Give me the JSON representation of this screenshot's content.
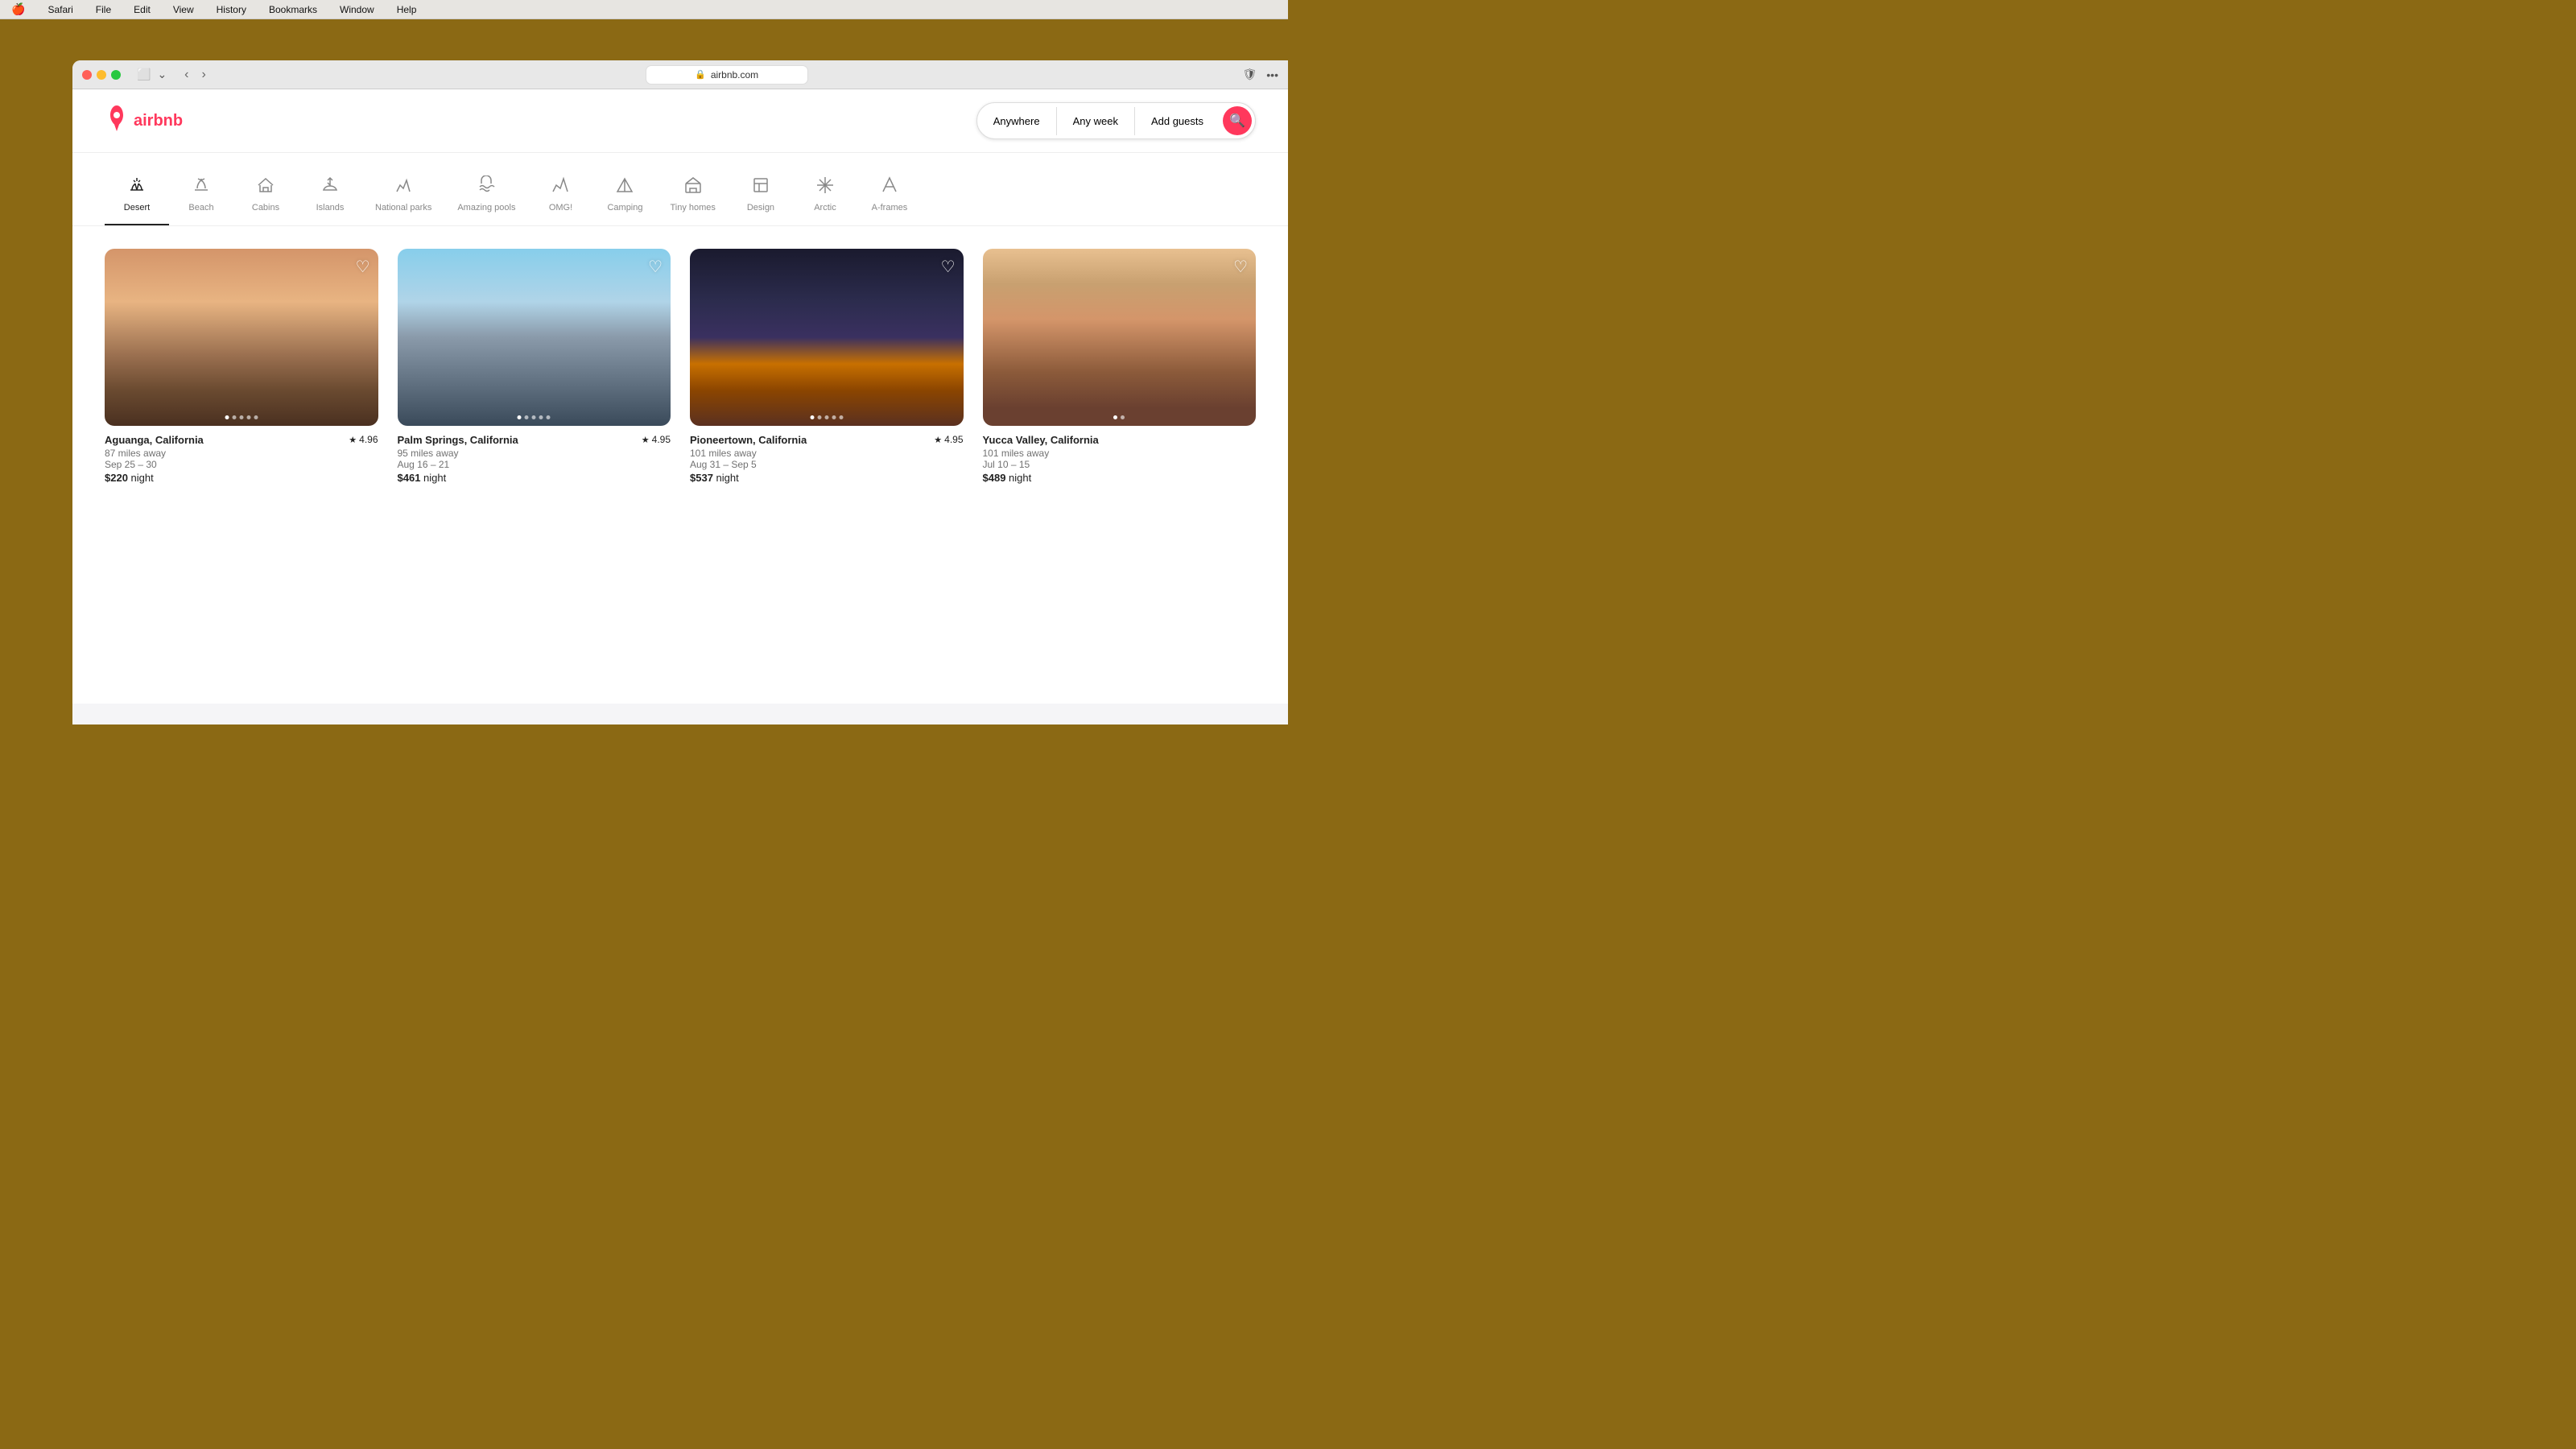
{
  "os": {
    "menu_items": [
      "🍎",
      "Safari",
      "File",
      "Edit",
      "View",
      "History",
      "Bookmarks",
      "Window",
      "Help"
    ]
  },
  "browser": {
    "url": "airbnb.com",
    "back_arrow": "‹",
    "forward_arrow": "›"
  },
  "header": {
    "logo_text": "airbnb",
    "search": {
      "anywhere": "Anywhere",
      "any_week": "Any week",
      "add_guests": "Add guests"
    }
  },
  "categories": [
    {
      "id": "desert",
      "label": "Desert",
      "icon": "🌵",
      "active": true
    },
    {
      "id": "beach",
      "label": "Beach",
      "icon": "⛱",
      "active": false
    },
    {
      "id": "cabins",
      "label": "Cabins",
      "icon": "🏠",
      "active": false
    },
    {
      "id": "islands",
      "label": "Islands",
      "icon": "🌴",
      "active": false
    },
    {
      "id": "national-parks",
      "label": "National parks",
      "icon": "⛰",
      "active": false
    },
    {
      "id": "amazing-pools",
      "label": "Amazing pools",
      "icon": "♒",
      "active": false
    },
    {
      "id": "omg",
      "label": "OMG!",
      "icon": "🏔",
      "active": false
    },
    {
      "id": "camping",
      "label": "Camping",
      "icon": "⛺",
      "active": false
    },
    {
      "id": "tiny-homes",
      "label": "Tiny homes",
      "icon": "🏘",
      "active": false
    },
    {
      "id": "design",
      "label": "Design",
      "icon": "🏢",
      "active": false
    },
    {
      "id": "arctic",
      "label": "Arctic",
      "icon": "❄",
      "active": false
    },
    {
      "id": "a-frames",
      "label": "A-frames",
      "icon": "🔺",
      "active": false
    }
  ],
  "listings": [
    {
      "id": 1,
      "location": "Aguanga, California",
      "distance": "87 miles away",
      "dates": "Sep 25 – 30",
      "price": "$220",
      "price_unit": "night",
      "rating": "4.96",
      "dots": 5,
      "active_dot": 0
    },
    {
      "id": 2,
      "location": "Palm Springs, California",
      "distance": "95 miles away",
      "dates": "Aug 16 – 21",
      "price": "$461",
      "price_unit": "night",
      "rating": "4.95",
      "dots": 5,
      "active_dot": 0
    },
    {
      "id": 3,
      "location": "Pioneertown, California",
      "distance": "101 miles away",
      "dates": "Aug 31 – Sep 5",
      "price": "$537",
      "price_unit": "night",
      "rating": "4.95",
      "dots": 5,
      "active_dot": 0
    },
    {
      "id": 4,
      "location": "Yucca Valley, California",
      "distance": "101 miles away",
      "dates": "Jul 10 – 15",
      "price": "$489",
      "price_unit": "night",
      "rating": "",
      "dots": 2,
      "active_dot": 0
    }
  ]
}
